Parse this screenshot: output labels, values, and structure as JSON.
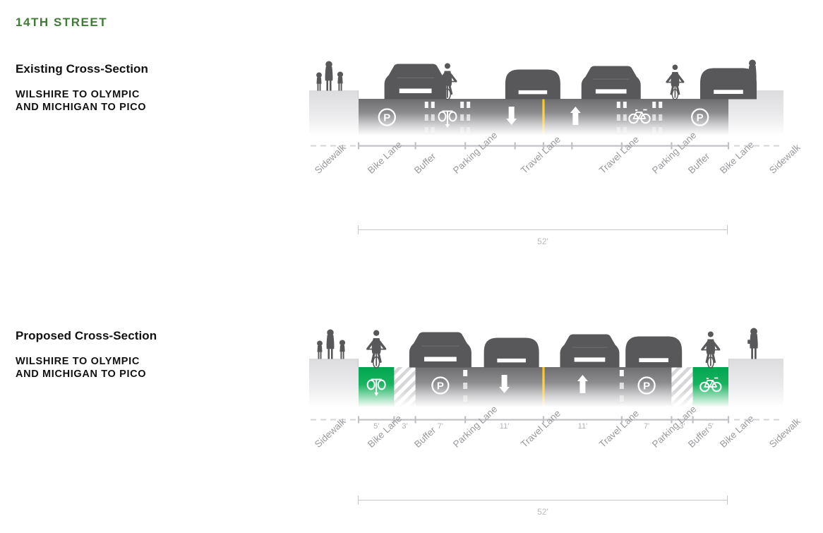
{
  "street": {
    "title": "14TH STREET"
  },
  "sections": [
    {
      "id": "existing",
      "heading": "Existing Cross-Section",
      "subheading_line1": "WILSHIRE TO OLYMPIC",
      "subheading_line2": "AND MICHIGAN TO PICO",
      "total_width": "52'",
      "lane_names": [
        "Sidewalk",
        "Bike Lane",
        "Buffer",
        "Parking Lane",
        "Travel Lane",
        "Travel Lane",
        "Parking Lane",
        "Buffer",
        "Bike Lane",
        "Sidewalk"
      ],
      "dimension_labels": [
        "",
        "",
        "",
        "",
        "",
        "",
        "",
        ""
      ],
      "lanes": [
        {
          "name": "sidewalk-left",
          "kind": "sidewalk",
          "marking": "none"
        },
        {
          "name": "parking-lane-left",
          "kind": "roadway",
          "marking": "parking-p"
        },
        {
          "name": "buffer-left-outer",
          "kind": "roadway",
          "marking": "double-dash"
        },
        {
          "name": "bike-lane-left",
          "kind": "roadway",
          "marking": "bike-front"
        },
        {
          "name": "buffer-left-inner",
          "kind": "roadway",
          "marking": "double-dash"
        },
        {
          "name": "travel-lane-left",
          "kind": "roadway",
          "marking": "arrow-down"
        },
        {
          "name": "travel-lane-right",
          "kind": "roadway",
          "marking": "arrow-up"
        },
        {
          "name": "buffer-right-inner",
          "kind": "roadway",
          "marking": "double-dash"
        },
        {
          "name": "bike-lane-right",
          "kind": "roadway",
          "marking": "bike-side"
        },
        {
          "name": "buffer-right-outer",
          "kind": "roadway",
          "marking": "double-dash"
        },
        {
          "name": "parking-lane-right",
          "kind": "roadway",
          "marking": "parking-p"
        },
        {
          "name": "sidewalk-right",
          "kind": "sidewalk",
          "marking": "none"
        }
      ]
    },
    {
      "id": "proposed",
      "heading": "Proposed Cross-Section",
      "subheading_line1": "WILSHIRE TO OLYMPIC",
      "subheading_line2": "AND MICHIGAN TO PICO",
      "total_width": "52'",
      "lane_names": [
        "Sidewalk",
        "Bike Lane",
        "Buffer",
        "Parking Lane",
        "Travel Lane",
        "Travel Lane",
        "Parking Lane",
        "Buffer",
        "Bike Lane",
        "Sidewalk"
      ],
      "dimension_labels": [
        "5'",
        "3'",
        "7'",
        "11'",
        "11'",
        "7'",
        "3'",
        "5'"
      ],
      "lanes": [
        {
          "name": "sidewalk-left",
          "kind": "sidewalk",
          "marking": "none"
        },
        {
          "name": "bike-lane-left",
          "kind": "green-bike",
          "marking": "bike-front"
        },
        {
          "name": "buffer-left",
          "kind": "hatched",
          "marking": "hatch"
        },
        {
          "name": "parking-lane-left",
          "kind": "roadway",
          "marking": "parking-p"
        },
        {
          "name": "travel-lane-left",
          "kind": "roadway",
          "marking": "arrow-down"
        },
        {
          "name": "travel-lane-right",
          "kind": "roadway",
          "marking": "arrow-up"
        },
        {
          "name": "parking-lane-right",
          "kind": "roadway",
          "marking": "parking-p"
        },
        {
          "name": "buffer-right",
          "kind": "hatched",
          "marking": "hatch"
        },
        {
          "name": "bike-lane-right",
          "kind": "green-bike",
          "marking": "bike-side"
        },
        {
          "name": "sidewalk-right",
          "kind": "sidewalk",
          "marking": "none"
        }
      ]
    }
  ],
  "colors": {
    "brand_green": "#3f7d35",
    "bike_lane_green": "#00a550",
    "road_dark": "#6e6e70",
    "centerline_yellow": "#ffc20e",
    "label_gray": "#9a9a9e",
    "rule_gray": "#c9c7cb",
    "sidewalk_gray": "#d9d9db",
    "vehicle_gray": "#58585a"
  }
}
